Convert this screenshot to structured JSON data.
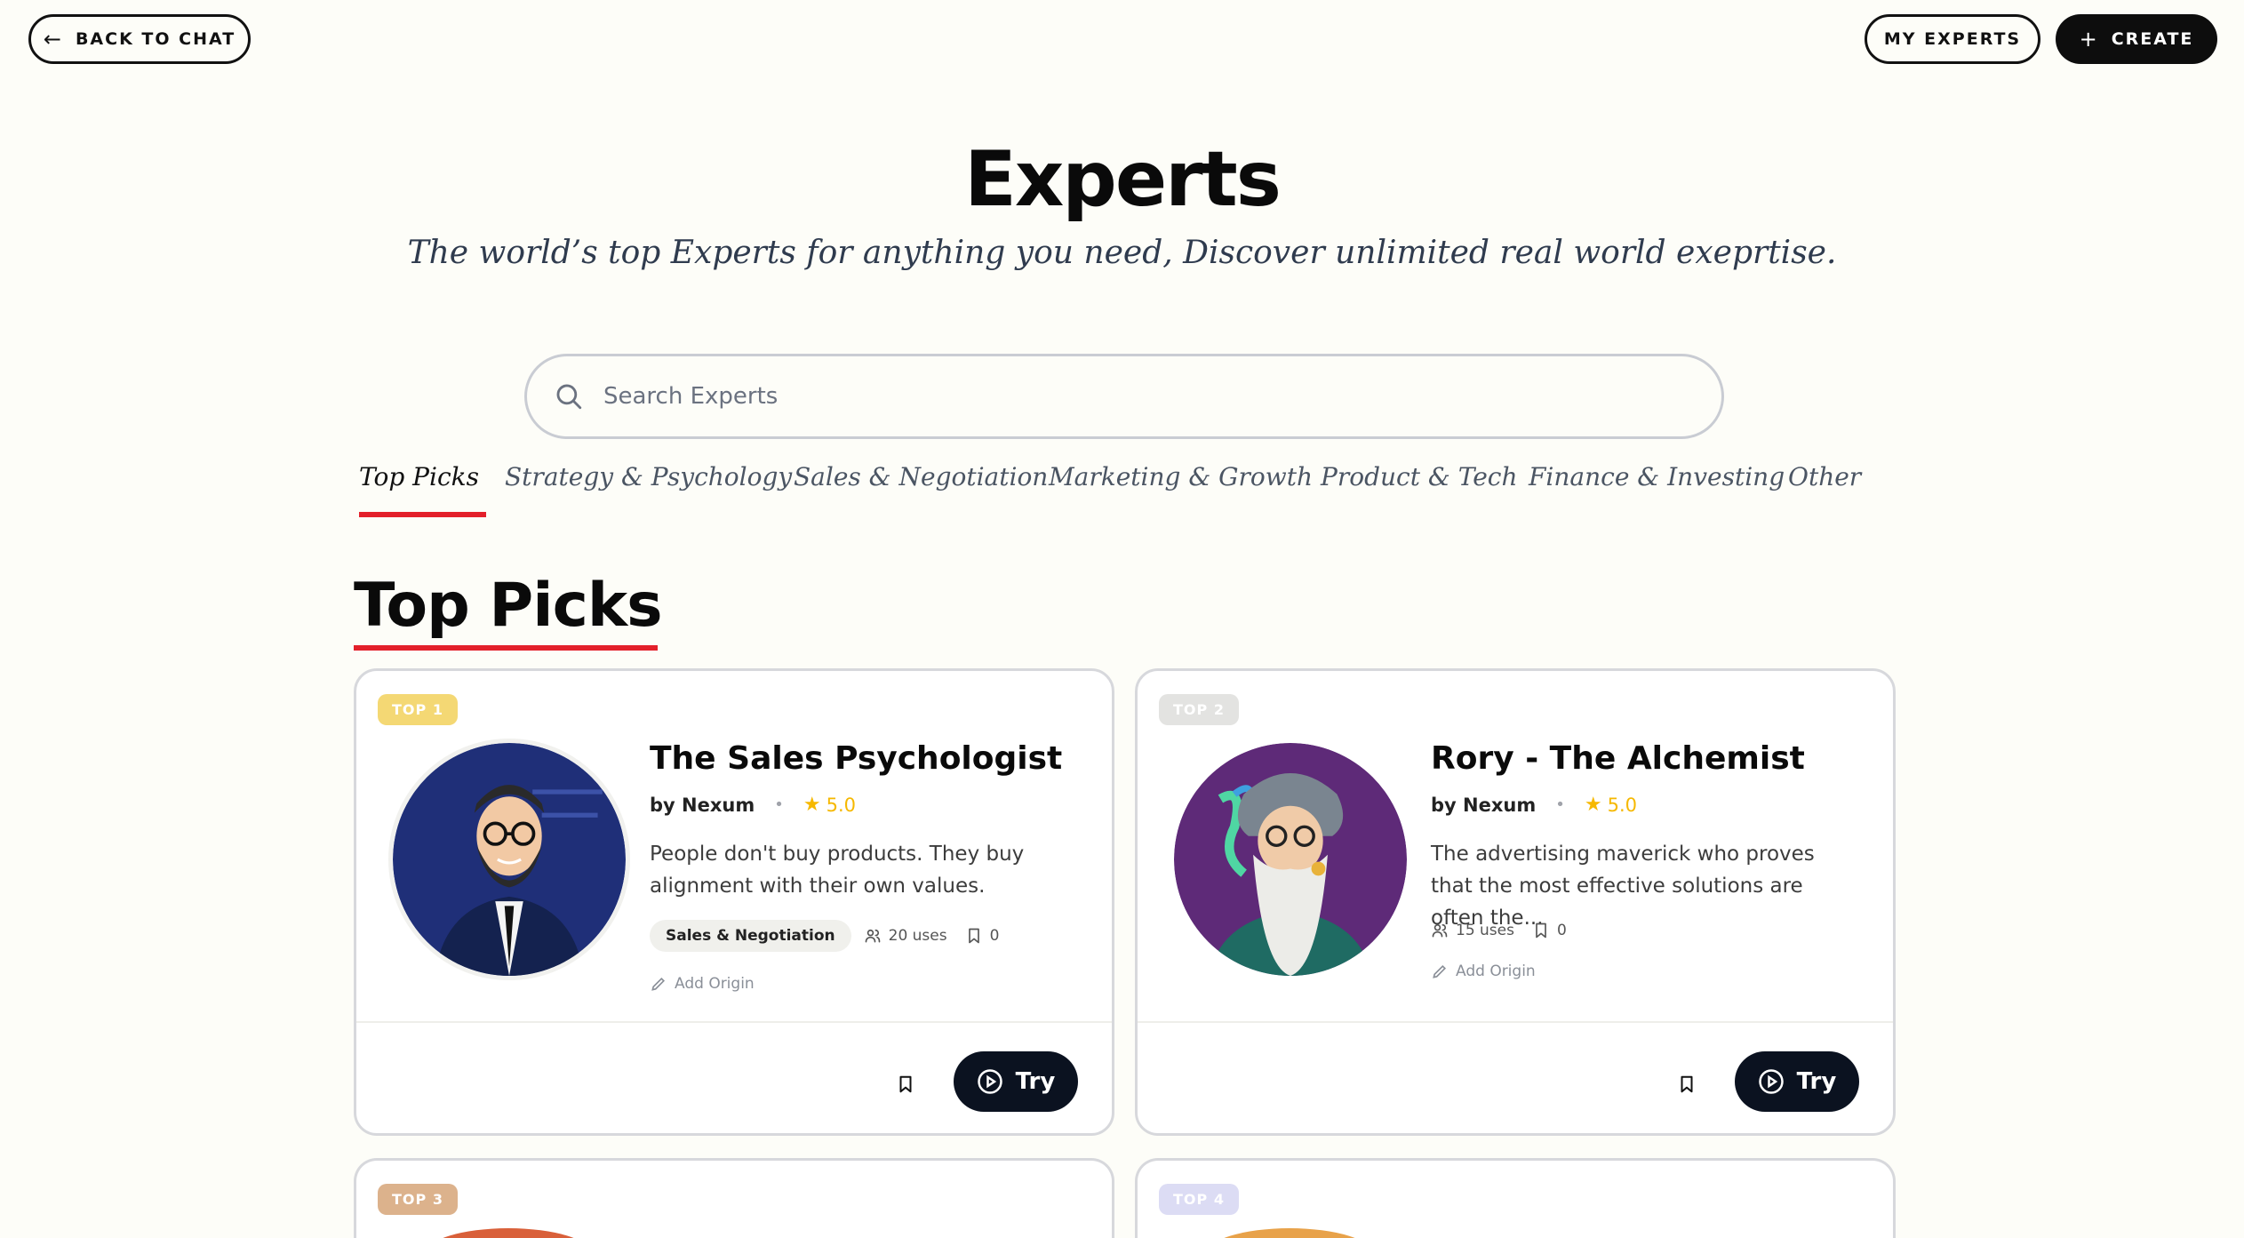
{
  "header": {
    "back_label": "BACK TO CHAT",
    "my_experts_label": "MY EXPERTS",
    "create_label": "CREATE"
  },
  "page": {
    "title": "Experts",
    "subtitle": "The world’s top Experts for anything you need, Discover unlimited real world exeprtise."
  },
  "search": {
    "placeholder": "Search Experts",
    "value": ""
  },
  "tabs": [
    {
      "label": "Top Picks",
      "active": true
    },
    {
      "label": "Strategy & Psychology",
      "active": false
    },
    {
      "label": "Sales & Negotiation",
      "active": false
    },
    {
      "label": "Marketing & Growth",
      "active": false
    },
    {
      "label": "Product & Tech",
      "active": false
    },
    {
      "label": "Finance & Investing",
      "active": false
    },
    {
      "label": "Other",
      "active": false
    }
  ],
  "section": {
    "title": "Top Picks"
  },
  "accent_color": "#e3202b",
  "cards": [
    {
      "badge": "TOP 1",
      "badge_color": "#f4d874",
      "title": "The Sales Psychologist",
      "author": "by Nexum",
      "rating": "5.0",
      "description": "People don't buy products. They buy alignment with their own values.",
      "tag": "Sales & Negotiation",
      "uses": "20 uses",
      "saves": "0",
      "add_origin": "Add Origin",
      "try_label": "Try",
      "avatar_icon": "bearded-salesman-avatar"
    },
    {
      "badge": "TOP 2",
      "badge_color": "#e3e3e1",
      "title": "Rory - The Alchemist",
      "author": "by Nexum",
      "rating": "5.0",
      "description": "The advertising maverick who proves that the most effective solutions are often the...",
      "uses": "15 uses",
      "saves": "0",
      "add_origin": "Add Origin",
      "try_label": "Try",
      "avatar_icon": "wizard-alchemist-avatar"
    },
    {
      "badge": "TOP 3",
      "badge_color": "#dcb28c"
    },
    {
      "badge": "TOP 4",
      "badge_color": "#dcdcf4"
    }
  ]
}
